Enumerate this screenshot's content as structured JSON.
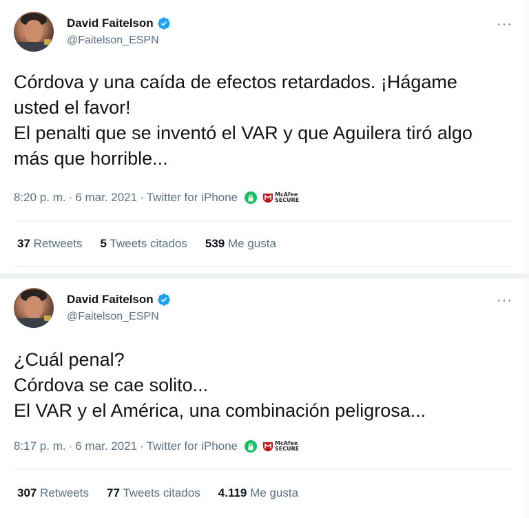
{
  "tweets": [
    {
      "author": {
        "name": "David Faitelson",
        "handle": "@Faitelson_ESPN"
      },
      "text": "Córdova y una caída de efectos retardados. ¡Hágame\nusted el favor!\nEl penalti que se inventó el VAR y que Aguilera tiró algo\nmás que horrible...",
      "time": "8:20 p. m.",
      "date": "6 mar. 2021",
      "source": "Twitter for iPhone",
      "badge": {
        "line1": "McAfee",
        "line2": "SECURE"
      },
      "stats": {
        "retweets_count": "37",
        "retweets_label": "Retweets",
        "quotes_count": "5",
        "quotes_label": "Tweets citados",
        "likes_count": "539",
        "likes_label": "Me gusta"
      }
    },
    {
      "author": {
        "name": "David Faitelson",
        "handle": "@Faitelson_ESPN"
      },
      "text": "¿Cuál penal?\nCórdova se cae solito...\nEl VAR y el América, una combinación peligrosa...",
      "time": "8:17 p. m.",
      "date": "6 mar. 2021",
      "source": "Twitter for iPhone",
      "badge": {
        "line1": "McAfee",
        "line2": "SECURE"
      },
      "stats": {
        "retweets_count": "307",
        "retweets_label": "Retweets",
        "quotes_count": "77",
        "quotes_label": "Tweets citados",
        "likes_count": "4.119",
        "likes_label": "Me gusta"
      }
    }
  ],
  "ui": {
    "more_glyph": "···",
    "dot": "·"
  },
  "colors": {
    "accent": "#1da1f2",
    "secondary_text": "#5b7083",
    "lock_green": "#17bf63",
    "mcafee_red": "#c01818"
  }
}
